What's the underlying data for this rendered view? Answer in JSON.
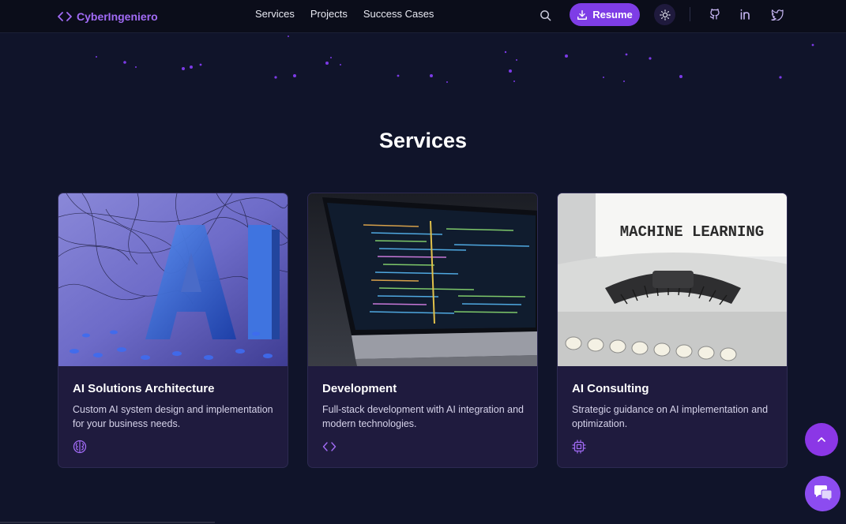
{
  "nav": {
    "brand": "CyberIngeniero",
    "links": [
      "Services",
      "Projects",
      "Success Cases"
    ],
    "resume_label": "Resume",
    "icons": [
      "search-icon",
      "download-icon",
      "sun-icon",
      "github-icon",
      "linkedin-icon",
      "twitter-icon"
    ]
  },
  "section": {
    "title": "Services"
  },
  "cards": [
    {
      "title": "AI Solutions Architecture",
      "description": "Custom AI system design and implementation for your business needs.",
      "icon": "brain-icon",
      "image": "ai-3d-letters-image"
    },
    {
      "title": "Development",
      "description": "Full-stack development with AI integration and modern technologies.",
      "icon": "code-icon",
      "image": "laptop-code-image"
    },
    {
      "title": "AI Consulting",
      "description": "Strategic guidance on AI implementation and optimization.",
      "icon": "cpu-icon",
      "image": "typewriter-image",
      "image_text": "MACHINE LEARNING"
    }
  ],
  "colors": {
    "background": "#10142a",
    "accent": "#8b37e6",
    "card": "#1f1b3e"
  },
  "floating": {
    "icons": [
      "chevron-up-icon",
      "chat-icon"
    ]
  }
}
